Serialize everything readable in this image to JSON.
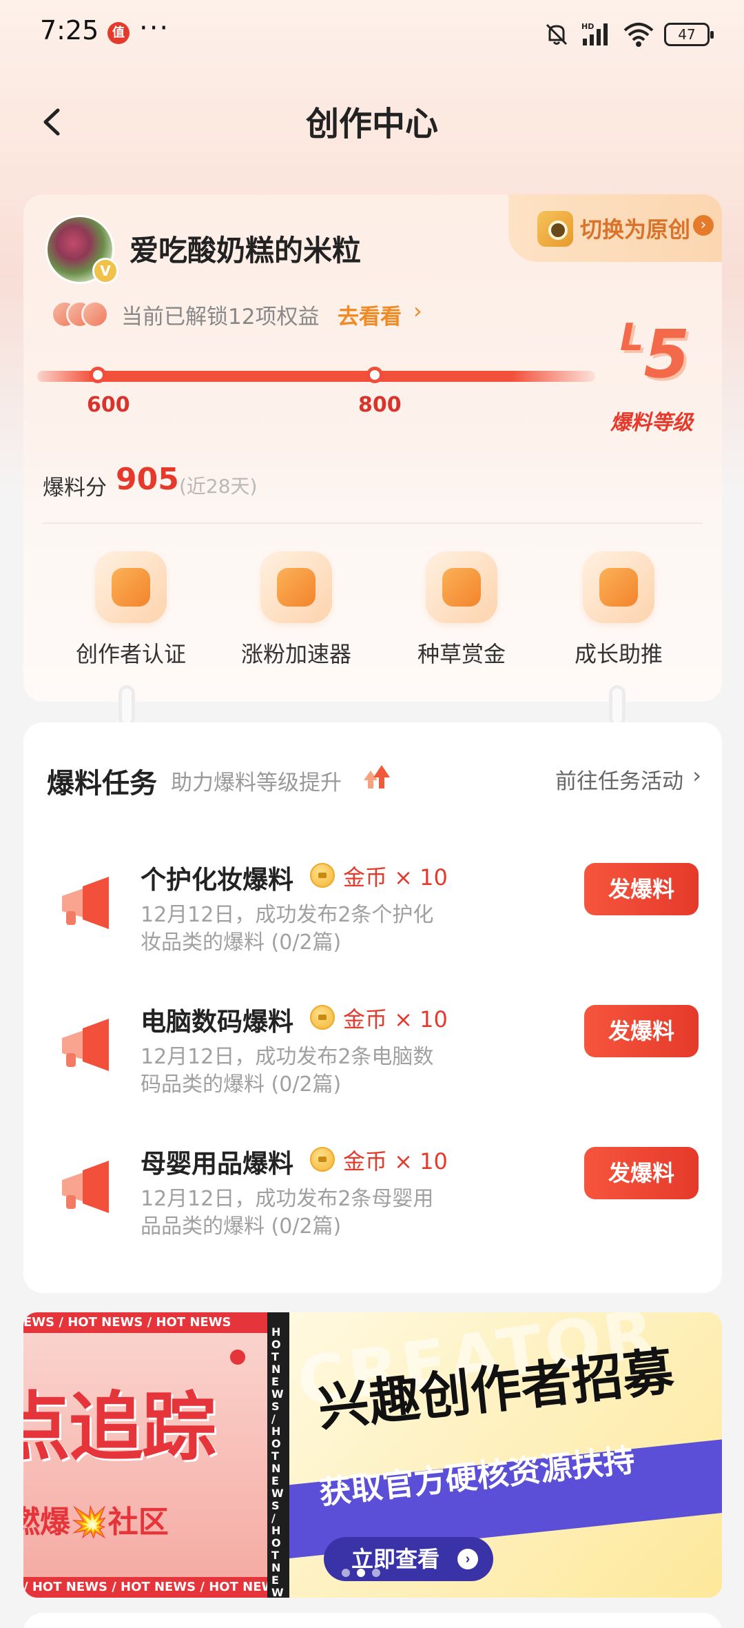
{
  "status_bar": {
    "time": "7:25",
    "notification_badge": "值",
    "overflow": "···",
    "battery": "47"
  },
  "header": {
    "title": "创作中心"
  },
  "profile": {
    "username": "爱吃酸奶糕的米粒",
    "switch_label": "切换为原创",
    "rights_text": "当前已解锁12项权益",
    "rights_link": "去看看",
    "progress": {
      "min_label": "600",
      "max_label": "800"
    },
    "level": {
      "value": "5",
      "prefix": "L",
      "caption": "爆料等级"
    },
    "score_label": "爆料分",
    "score_value": "905",
    "score_note": "(近28天)"
  },
  "quick_actions": [
    {
      "label": "创作者认证",
      "icon": "creator-certification-icon"
    },
    {
      "label": "涨粉加速器",
      "icon": "follower-boost-icon"
    },
    {
      "label": "种草赏金",
      "icon": "seeding-bounty-icon"
    },
    {
      "label": "成长助推",
      "icon": "growth-boost-icon"
    }
  ],
  "tasks": {
    "title": "爆料任务",
    "subtitle": "助力爆料等级提升",
    "link": "前往任务活动",
    "items": [
      {
        "name": "个护化妆爆料",
        "reward": "金币 × 10",
        "desc": "12月12日，成功发布2条个护化妆品类的爆料 (0/2篇)",
        "button": "发爆料"
      },
      {
        "name": "电脑数码爆料",
        "reward": "金币 × 10",
        "desc": "12月12日，成功发布2条电脑数码品类的爆料 (0/2篇)",
        "button": "发爆料"
      },
      {
        "name": "母婴用品爆料",
        "reward": "金币 × 10",
        "desc": "12月12日，成功发布2条母婴用品品类的爆料 (0/2篇)",
        "button": "发爆料"
      }
    ]
  },
  "banner": {
    "ticker": "EWS / HOT NEWS / HOT NEWS",
    "ticker_bottom": "/ HOT NEWS / HOT NEWS / HOT NEWS",
    "ticker_vertical": "HOT NEWS / HOT NEWS / HOT NEWS /",
    "left_big": "点追踪",
    "left_small": "燃爆💥社区",
    "watermark": "CREATOR",
    "title": "兴趣创作者招募",
    "subtitle": "获取官方硬核资源扶持",
    "cta": "立即查看"
  },
  "colors": {
    "accent_red": "#e53a2b",
    "accent_orange": "#f08a24",
    "banner_purple": "#5a4fd6"
  }
}
